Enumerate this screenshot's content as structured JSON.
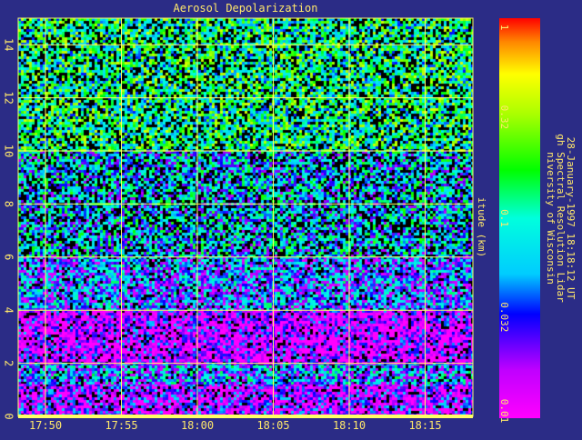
{
  "chart_data": {
    "type": "heatmap",
    "title": "Aerosol Depolarization",
    "ylabel": "itude (km)",
    "x_ticks": [
      "17:50",
      "17:55",
      "18:00",
      "18:05",
      "18:10",
      "18:15"
    ],
    "y_ticks": [
      "0",
      "2",
      "4",
      "6",
      "8",
      "10",
      "12",
      "14"
    ],
    "colorbar": {
      "scale": "log",
      "range": [
        0.01,
        1
      ],
      "ticks": [
        "0.01",
        "0.032",
        "0.1",
        "0.32",
        "1"
      ]
    },
    "side_text": {
      "line1": "niversity of Wisconsin",
      "line2": "gh Spectral Resolution Lidar",
      "line3": "28-January-1997 18:18:12 UT"
    },
    "altitude_bands": [
      {
        "from_km": 0,
        "to_km": 1.2,
        "value": 0.018
      },
      {
        "from_km": 1.2,
        "to_km": 2.0,
        "value": 0.045
      },
      {
        "from_km": 2.0,
        "to_km": 4.0,
        "value": 0.015
      },
      {
        "from_km": 4.0,
        "to_km": 6.0,
        "value": 0.04
      },
      {
        "from_km": 6.0,
        "to_km": 10.0,
        "value": 0.06
      },
      {
        "from_km": 10.0,
        "to_km": 15.0,
        "value": 0.12
      }
    ]
  },
  "colors": {
    "background": "#2b2c86",
    "text": "#ffe86b",
    "grid": "#ffff66",
    "no_data": "#000000"
  }
}
